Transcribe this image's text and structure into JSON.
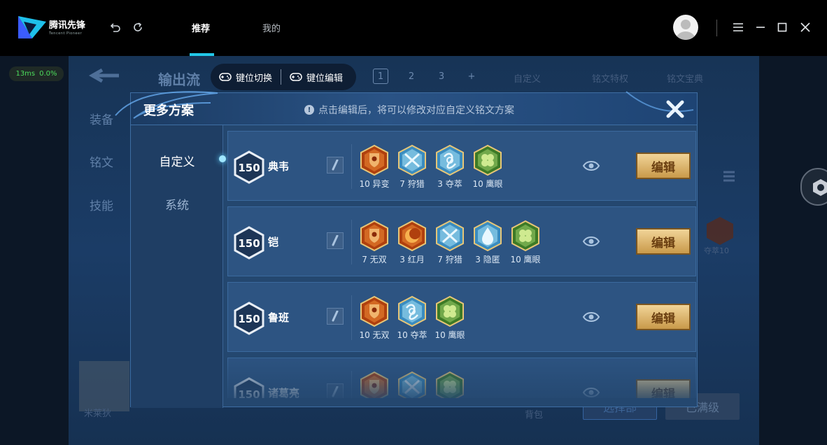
{
  "titlebar": {
    "brand_cn": "腾讯先锋",
    "brand_en": "Tencent Pioneer",
    "tabs": [
      {
        "label": "推荐",
        "active": true
      },
      {
        "label": "我的",
        "active": false
      }
    ]
  },
  "ping": {
    "latency": "13ms",
    "loss": "0.0%"
  },
  "background": {
    "title": "输出流",
    "left_menu": [
      "装备",
      "铭文",
      "技能"
    ],
    "numbers": [
      "1",
      "2",
      "3",
      "+"
    ],
    "custom": "自定义",
    "privilege": "铭文特权",
    "treasure": "铭文宝典",
    "hero_name": "米莱狄",
    "right_rune": "夺萃10",
    "bag": "背包",
    "btn_left": "选择部",
    "btn_right": "已满级"
  },
  "keybar": {
    "switch": "键位切换",
    "edit": "键位编辑"
  },
  "modal": {
    "title": "更多方案",
    "hint": "点击编辑后，将可以修改对应自定义铭文方案",
    "side": [
      {
        "label": "自定义",
        "active": true
      },
      {
        "label": "系统",
        "active": false
      }
    ],
    "edit_label": "编辑",
    "rows": [
      {
        "level": "150",
        "name": "典韦",
        "runes": [
          {
            "count": "10",
            "name": "异变",
            "color": "orange",
            "kind": "shield"
          },
          {
            "count": "7",
            "name": "狩猎",
            "color": "blue",
            "kind": "swords"
          },
          {
            "count": "3",
            "name": "夺萃",
            "color": "blue",
            "kind": "knot"
          },
          {
            "count": "10",
            "name": "鹰眼",
            "color": "green",
            "kind": "clover"
          }
        ]
      },
      {
        "level": "150",
        "name": "铠",
        "runes": [
          {
            "count": "7",
            "name": "无双",
            "color": "orange",
            "kind": "shield"
          },
          {
            "count": "3",
            "name": "红月",
            "color": "orange",
            "kind": "moon"
          },
          {
            "count": "7",
            "name": "狩猎",
            "color": "blue",
            "kind": "swords"
          },
          {
            "count": "3",
            "name": "隐匿",
            "color": "blue",
            "kind": "drop"
          },
          {
            "count": "10",
            "name": "鹰眼",
            "color": "green",
            "kind": "clover"
          }
        ]
      },
      {
        "level": "150",
        "name": "鲁班",
        "runes": [
          {
            "count": "10",
            "name": "无双",
            "color": "orange",
            "kind": "shield"
          },
          {
            "count": "10",
            "name": "夺萃",
            "color": "blue",
            "kind": "knot"
          },
          {
            "count": "10",
            "name": "鹰眼",
            "color": "green",
            "kind": "clover"
          }
        ]
      },
      {
        "level": "150",
        "name": "诸葛亮",
        "runes": [
          {
            "count": "",
            "name": "",
            "color": "orange",
            "kind": "shield"
          },
          {
            "count": "",
            "name": "",
            "color": "blue",
            "kind": "swords"
          },
          {
            "count": "",
            "name": "",
            "color": "green",
            "kind": "clover"
          }
        ]
      }
    ]
  },
  "colors": {
    "accent": "#22c8e8",
    "gold": "#d9b36a",
    "rune_orange": "#d8641e",
    "rune_blue": "#5ab0d8",
    "rune_green": "#6aa83a"
  }
}
